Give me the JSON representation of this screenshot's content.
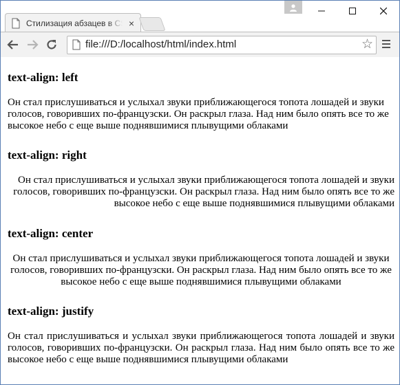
{
  "window": {
    "tab_title": "Стилизация абзацев в CSS",
    "tab_close": "×",
    "url": "file:///D:/localhost/html/index.html"
  },
  "icons": {
    "tab": "document-icon",
    "back": "back-arrow-icon",
    "forward": "forward-arrow-icon",
    "reload": "reload-icon",
    "page": "document-icon",
    "bookmark": "star-icon",
    "menu": "hamburger-menu-icon",
    "user": "user-icon"
  },
  "sections": [
    {
      "heading": "text-align: left",
      "paragraph": "Он стал прислушиваться и услыхал звуки приближающегося топота лошадей и звуки голосов, говоривших по-французски. Он раскрыл глаза. Над ним было опять все то же высокое небо с еще выше поднявшимися плывущими облаками"
    },
    {
      "heading": "text-align: right",
      "paragraph": "Он стал прислушиваться и услыхал звуки приближающегося топота лошадей и звуки голосов, говоривших по-французски. Он раскрыл глаза. Над ним было опять все то же высокое небо с еще выше поднявшимися плывущими облаками"
    },
    {
      "heading": "text-align: center",
      "paragraph": "Он стал прислушиваться и услыхал звуки приближающегося топота лошадей и звуки голосов, говоривших по-французски. Он раскрыл глаза. Над ним было опять все то же высокое небо с еще выше поднявшимися плывущими облаками"
    },
    {
      "heading": "text-align: justify",
      "paragraph": "Он стал прислушиваться и услыхал звуки приближающегося топота лошадей и звуки голосов, говоривших по-французски. Он раскрыл глаза. Над ним было опять все то же высокое небо с еще выше поднявшимися плывущими облаками"
    }
  ]
}
